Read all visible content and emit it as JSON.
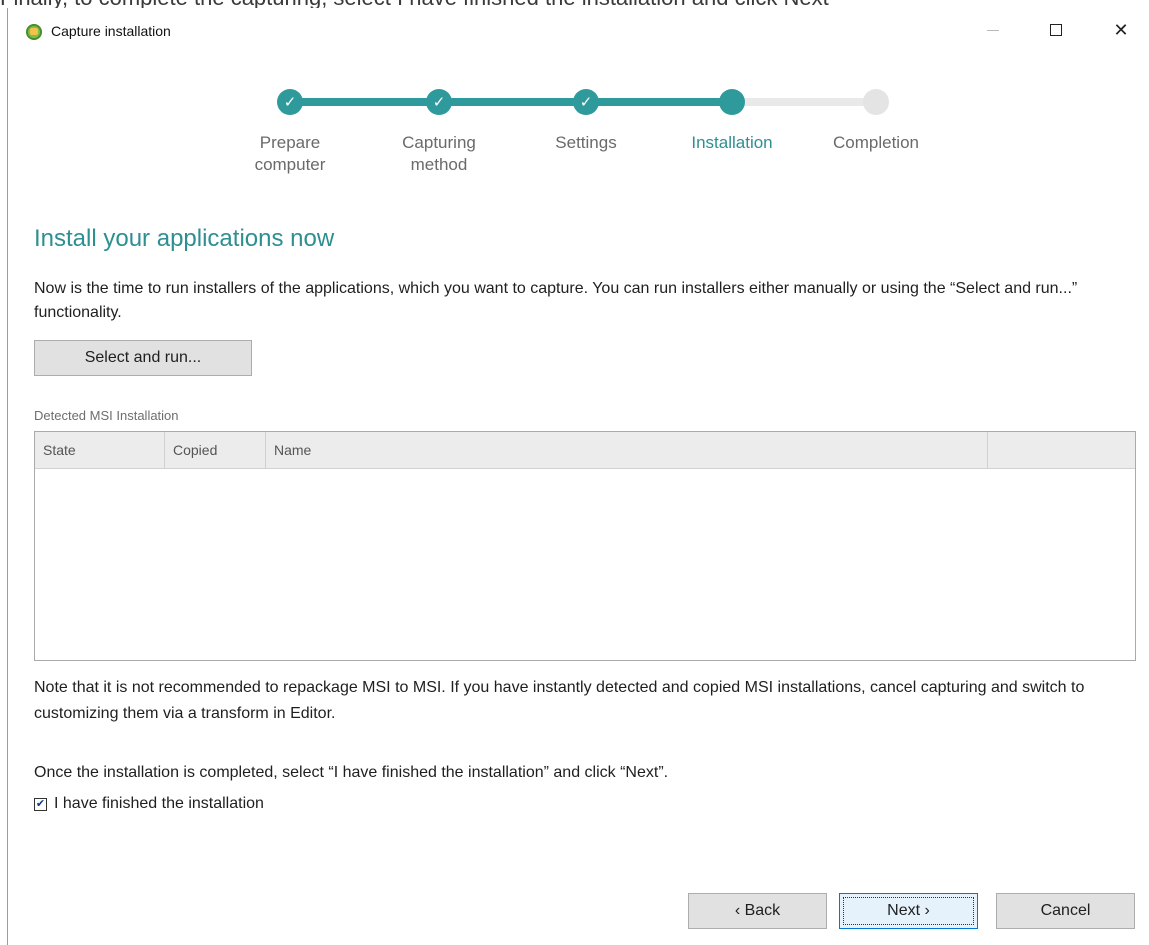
{
  "caption_text": "Finally, to complete the capturing, select I have finished the installation and click Next",
  "window": {
    "title": "Capture installation",
    "controls": {
      "minimize": "—",
      "maximize": "□",
      "close": "✕"
    }
  },
  "stepper": {
    "steps": [
      {
        "label": "Prepare\ncomputer",
        "state": "done"
      },
      {
        "label": "Capturing\nmethod",
        "state": "done"
      },
      {
        "label": "Settings",
        "state": "done"
      },
      {
        "label": "Installation",
        "state": "current"
      },
      {
        "label": "Completion",
        "state": "todo"
      }
    ],
    "check_glyph": "✓",
    "colors": {
      "accent": "#2e9a9c",
      "inactive": "#e4e4e4"
    }
  },
  "main": {
    "heading": "Install your applications now",
    "description": "Now is the time to run installers of the applications, which you want to capture. You can run installers either manually or using the “Select and run...” functionality.",
    "select_run_label": "Select and run...",
    "section_label": "Detected MSI Installation",
    "table": {
      "columns": [
        "State",
        "Copied",
        "Name",
        ""
      ],
      "rows": []
    },
    "note": "Note that it is not recommended to repackage MSI to MSI. If you have instantly detected and copied MSI installations, cancel capturing and switch to customizing them via a transform in Editor.",
    "instruction": "Once the installation is completed, select “I have finished the installation” and click “Next”.",
    "finished_checkbox": {
      "label": "I have finished the installation",
      "checked": true,
      "glyph": "✔"
    }
  },
  "footer": {
    "back_label": "‹ Back",
    "next_label": "Next ›",
    "cancel_label": "Cancel"
  }
}
